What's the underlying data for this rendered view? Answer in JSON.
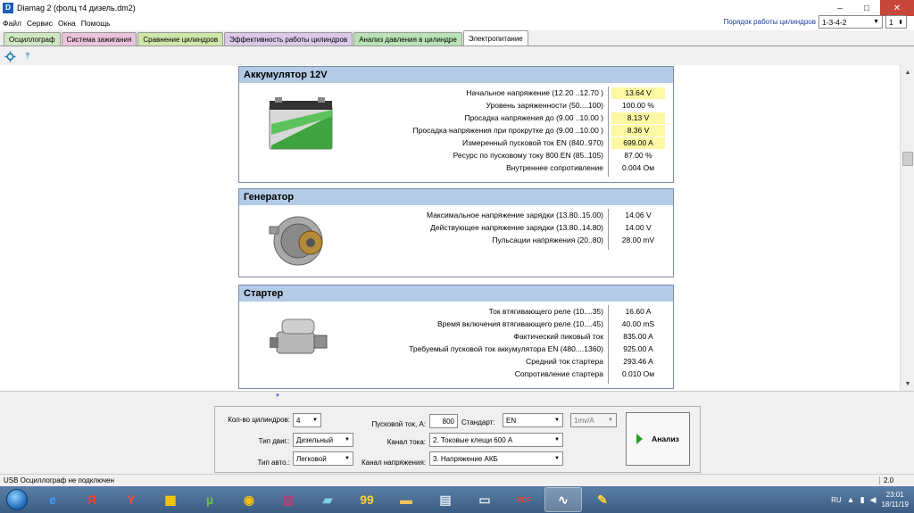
{
  "window": {
    "title": "Diamag 2 (фолц т4 дизель.dm2)",
    "controls": {
      "minimize": "–",
      "maximize": "□",
      "close": "✕"
    }
  },
  "menu": [
    "Файл",
    "Сервис",
    "Окна",
    "Помощь"
  ],
  "cylinder_order": {
    "label": "Порядок работы цилиндров",
    "value": "1-3-4-2",
    "index": "1"
  },
  "tabs": [
    {
      "label": "Осциллограф",
      "color": "#cfe7c2"
    },
    {
      "label": "Система зажигания",
      "color": "#ecc3dc"
    },
    {
      "label": "Сравнение цилиндров",
      "color": "#cfe7a8"
    },
    {
      "label": "Эффективность работы цилиндров",
      "color": "#dcc9e8"
    },
    {
      "label": "Анализ давления в цилиндре",
      "color": "#b9e2b6"
    },
    {
      "label": "Электропитание",
      "color": "#ffffff"
    }
  ],
  "toolbar": {
    "tool1_icon": "settings-icon",
    "tool2_icon": "measure-icon",
    "tool2_glyph": "⤒"
  },
  "battery": {
    "title": "Аккумулятор 12V",
    "rows": [
      {
        "label": "Начальное напряжение (12.20 ..12.70 )",
        "value": "13.64 V",
        "highlight": true
      },
      {
        "label": "Уровень заряженности (50....100)",
        "value": "100.00 %",
        "highlight": false
      },
      {
        "label": "Просадка напряжения до (9.00 ..10.00 )",
        "value": "8.13 V",
        "highlight": true
      },
      {
        "label": "Просадка напряжения при прокрутке до (9.00 ..10.00 )",
        "value": "8.36 V",
        "highlight": true
      },
      {
        "label": "Измеренный пусковой ток  EN (840..970)",
        "value": "699.00 A",
        "highlight": true
      },
      {
        "label": "Ресурс по пусковому току  800 EN (85..105)",
        "value": "87.00 %",
        "highlight": false
      },
      {
        "label": "Внутреннее сопротивление",
        "value": "0.004 Ом",
        "highlight": false
      }
    ]
  },
  "generator": {
    "title": "Генератор",
    "rows": [
      {
        "label": "Максимальное напряжение зарядки  (13.80..15.00)",
        "value": "14.06 V"
      },
      {
        "label": "Действующее напряжение зарядки  (13.80..14.80)",
        "value": "14.00 V"
      },
      {
        "label": "Пульсации напряжения (20..80)",
        "value": "28.00 mV"
      }
    ]
  },
  "starter": {
    "title": "Стартер",
    "rows": [
      {
        "label": "Ток втягивающего реле (10....35)",
        "value": "16.60 A"
      },
      {
        "label": "Время включения втягивающего реле (10....45)",
        "value": "40.00 mS"
      },
      {
        "label": "Фактический пиковый ток",
        "value": "835.00 A"
      },
      {
        "label": "Требуемый пусковой ток аккумулятора  EN (480....1360)",
        "value": "925.00 A"
      },
      {
        "label": "Средний ток стартера",
        "value": "293.46 A"
      },
      {
        "label": "Сопротивление стартера",
        "value": "0.010 Ом"
      }
    ]
  },
  "settings": {
    "cylinders_label": "Кол-во цилиндров:",
    "cylinders_value": "4",
    "engine_label": "Тип двиг.:",
    "engine_value": "Дизельный",
    "car_label": "Тип авто.:",
    "car_value": "Легковой",
    "start_current_label": "Пусковой ток, А:",
    "start_current_value": "800",
    "standard_label": "Стандарт:",
    "standard_value": "EN",
    "current_channel_label": "Канал тока:",
    "current_channel_value": "2. Токовые клещи 600 А",
    "voltage_channel_label": "Канал напряжения:",
    "voltage_channel_value": "3. Напряжение АКБ",
    "scale_value": "1mv/A",
    "analyze_label": "Анализ"
  },
  "status": {
    "left": "USB Осциллограф не подключен",
    "right": "2.0"
  },
  "taskbar": {
    "apps": [
      {
        "icon": "ie-icon",
        "glyph": "e",
        "color": "#3aa0ff"
      },
      {
        "icon": "yandex-icon",
        "glyph": "Я",
        "color": "#ff3b2f"
      },
      {
        "icon": "yandex-browser-icon",
        "glyph": "Y",
        "color": "#ff4a3d"
      },
      {
        "icon": "cube-icon",
        "glyph": "▦",
        "color": "#ffcc00"
      },
      {
        "icon": "utorrent-icon",
        "glyph": "µ",
        "color": "#6dc24b"
      },
      {
        "icon": "chrome-icon",
        "glyph": "◉",
        "color": "#f4c20d"
      },
      {
        "icon": "winrar-icon",
        "glyph": "▥",
        "color": "#b0407a"
      },
      {
        "icon": "app-icon",
        "glyph": "▰",
        "color": "#7fd0e0"
      },
      {
        "icon": "total-commander-icon",
        "glyph": "99",
        "color": "#ffd23a"
      },
      {
        "icon": "folder-icon",
        "glyph": "▬",
        "color": "#f2c35a"
      },
      {
        "icon": "calculator-icon",
        "glyph": "▤",
        "color": "#dde6f0"
      },
      {
        "icon": "monitor-icon",
        "glyph": "▭",
        "color": "#dde6f0"
      },
      {
        "icon": "pdf-icon",
        "glyph": "PDF",
        "color": "#e34a3a"
      },
      {
        "icon": "diamag-icon",
        "glyph": "∿",
        "color": "#ffffff"
      },
      {
        "icon": "paint-icon",
        "glyph": "✎",
        "color": "#ffd23a"
      }
    ],
    "lang": "RU",
    "time": "23:01",
    "date": "18/11/19"
  }
}
